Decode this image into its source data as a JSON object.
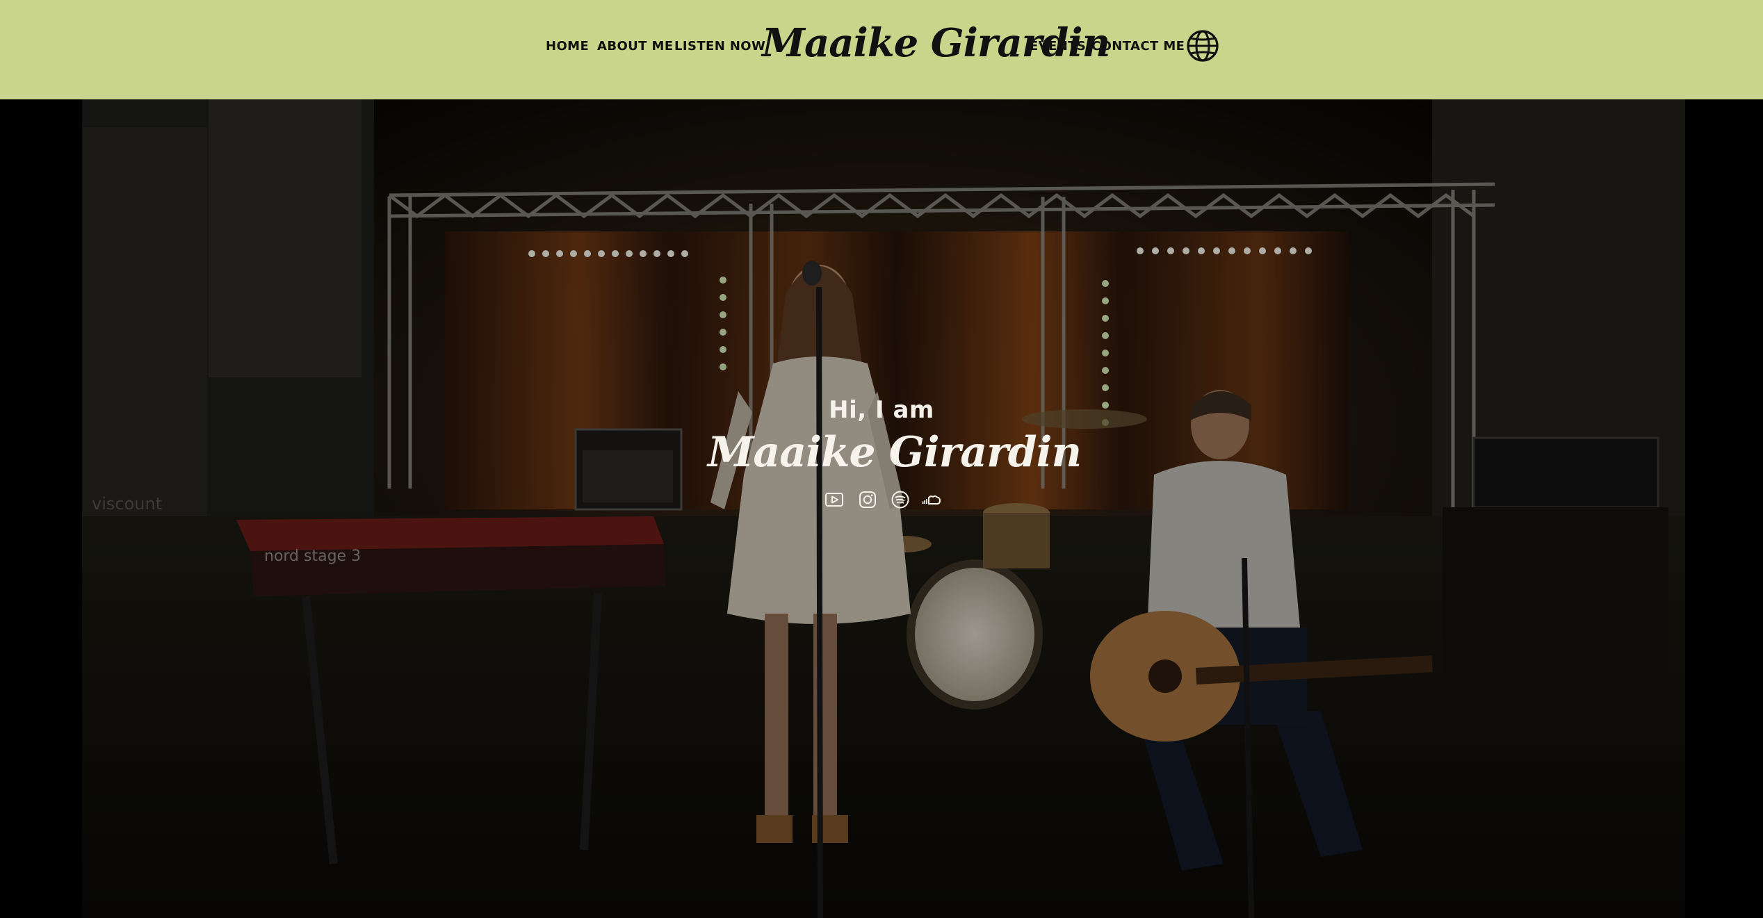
{
  "header": {
    "nav_left": [
      {
        "label": "HOME"
      },
      {
        "label": "ABOUT ME"
      },
      {
        "label": "LISTEN NOW"
      }
    ],
    "brand": "Maaike Girardin",
    "nav_right": [
      {
        "label": "EVENTS"
      },
      {
        "label": "CONTACT ME"
      }
    ],
    "language_icon": "globe-icon"
  },
  "hero": {
    "greeting": "Hi, I am",
    "name": "Maaike Girardin",
    "social_icons": [
      "youtube-icon",
      "instagram-icon",
      "spotify-icon",
      "soundcloud-icon"
    ],
    "stage_text": {
      "keyboard_label": "nord stage 3",
      "wall_label": "viscount"
    }
  },
  "colors": {
    "header_bg": "#c9d58a",
    "nav_text": "#111111",
    "hero_text": "#f6f3ec"
  }
}
